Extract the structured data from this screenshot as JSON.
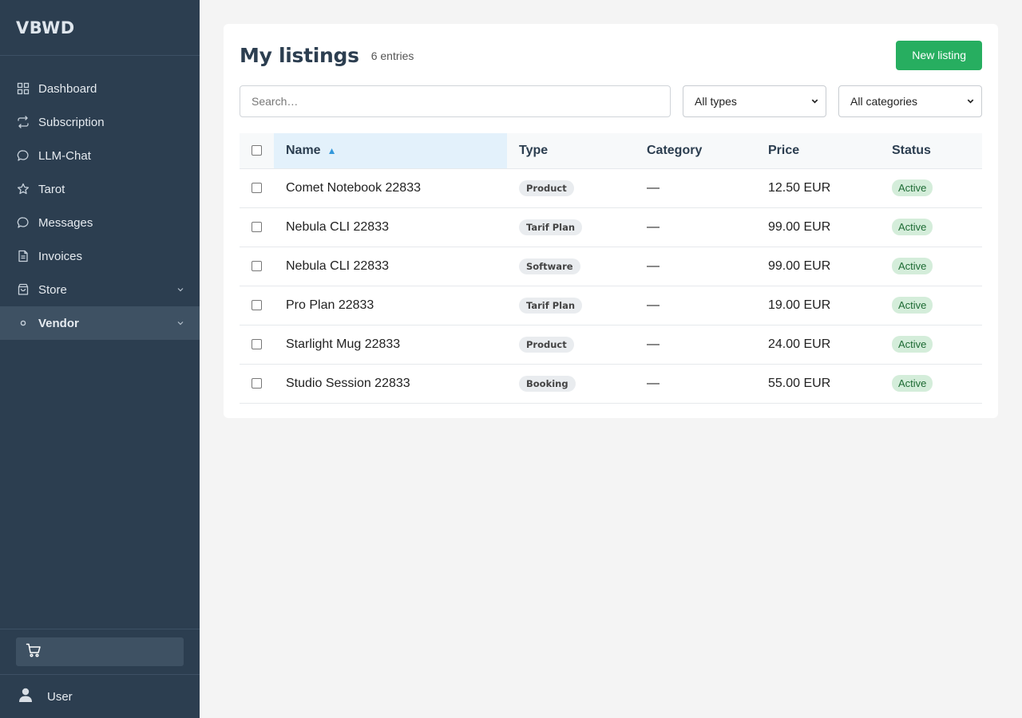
{
  "sidebar": {
    "brand": "VBWD",
    "items": [
      {
        "label": "Dashboard"
      },
      {
        "label": "Subscription"
      },
      {
        "label": "LLM-Chat"
      },
      {
        "label": "Tarot"
      },
      {
        "label": "Messages"
      },
      {
        "label": "Invoices"
      },
      {
        "label": "Store"
      },
      {
        "label": "Vendor"
      }
    ],
    "active_item": "Vendor",
    "user_label": "User"
  },
  "main": {
    "title": "My listings",
    "count": "6 entries",
    "new_button": "New listing",
    "search_placeholder": "Search…",
    "type_filter": "All types",
    "category_filter": "All categories",
    "columns": {
      "name": "Name",
      "type": "Type",
      "category": "Category",
      "price": "Price",
      "status": "Status"
    },
    "sort": {
      "column": "Name",
      "direction": "ascending",
      "indicator": "▲"
    },
    "rows": [
      {
        "name": "Comet Notebook 22833",
        "type": "Product",
        "category": "—",
        "price": "12.50 EUR",
        "status": "Active"
      },
      {
        "name": "Nebula CLI 22833",
        "type": "Tarif Plan",
        "category": "—",
        "price": "99.00 EUR",
        "status": "Active"
      },
      {
        "name": "Nebula CLI 22833",
        "type": "Software",
        "category": "—",
        "price": "99.00 EUR",
        "status": "Active"
      },
      {
        "name": "Pro Plan 22833",
        "type": "Tarif Plan",
        "category": "—",
        "price": "19.00 EUR",
        "status": "Active"
      },
      {
        "name": "Starlight Mug 22833",
        "type": "Product",
        "category": "—",
        "price": "24.00 EUR",
        "status": "Active"
      },
      {
        "name": "Studio Session 22833",
        "type": "Booking",
        "category": "—",
        "price": "55.00 EUR",
        "status": "Active"
      }
    ]
  },
  "colors": {
    "sidebar_bg": "#2c3e50",
    "active_item_bg": "#3e5163",
    "primary_button": "#27ae60",
    "sort_accent": "#3498db",
    "status_active_bg": "#d4edda"
  },
  "icons": {
    "dashboard": "grid-icon",
    "subscription": "repeat-icon",
    "llm_chat": "chat-bubble-icon",
    "tarot": "star-icon",
    "messages": "chat-bubble-icon",
    "invoices": "document-icon",
    "store": "shopping-bag-icon",
    "vendor": "circle-dot-icon",
    "cart": "cart-icon",
    "user": "person-icon"
  }
}
